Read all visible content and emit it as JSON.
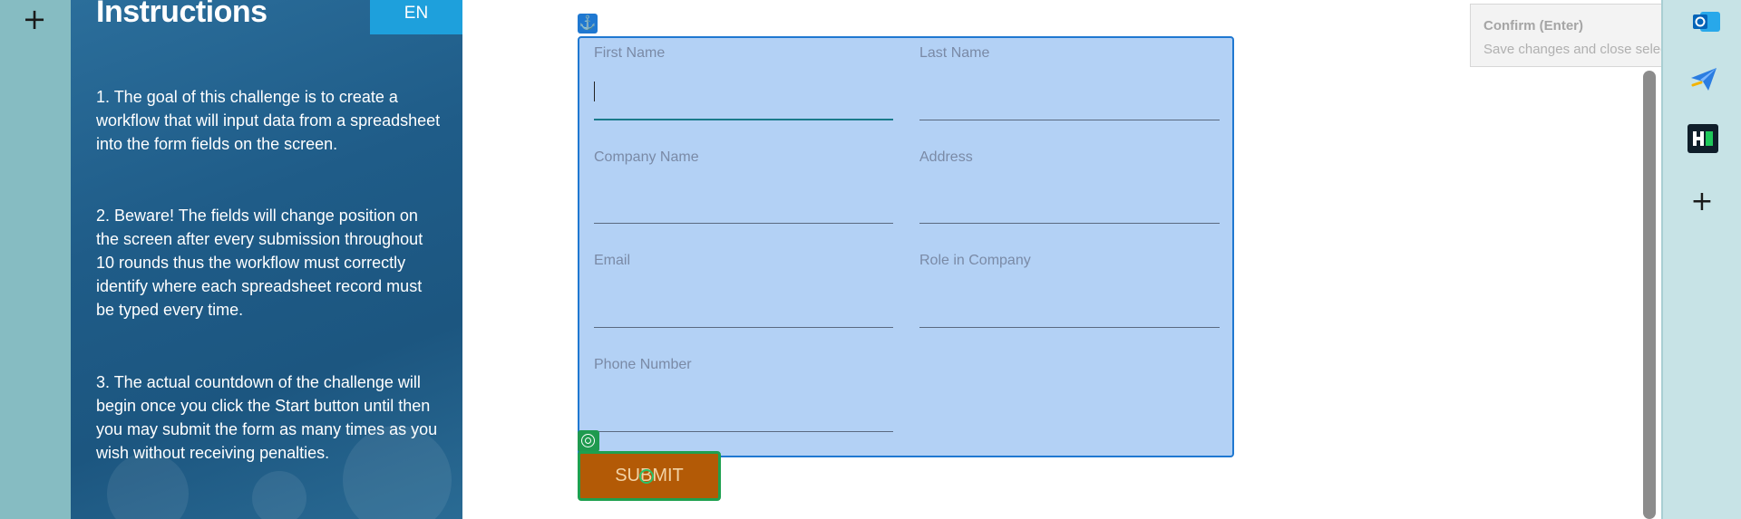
{
  "left_bar": {
    "add_label": "+"
  },
  "instructions": {
    "title": "Instructions",
    "language": "EN",
    "paragraphs": [
      "1. The goal of this challenge is to create a workflow that will input data from a spreadsheet into the form fields on the screen.",
      "2. Beware! The fields will change position on the screen after every submission throughout 10 rounds thus the workflow must correctly identify where each spreadsheet record must be typed every time.",
      "3. The actual countdown of the challenge will begin once you click the Start button until then you may submit the form as many times as you wish without receiving penalties."
    ]
  },
  "form": {
    "fields": [
      {
        "label": "First Name",
        "value": ""
      },
      {
        "label": "Last Name",
        "value": ""
      },
      {
        "label": "Company Name",
        "value": ""
      },
      {
        "label": "Address",
        "value": ""
      },
      {
        "label": "Email",
        "value": ""
      },
      {
        "label": "Role in Company",
        "value": ""
      },
      {
        "label": "Phone Number",
        "value": ""
      }
    ],
    "submit_label": "SUBMIT"
  },
  "tooltip": {
    "title": "Confirm (Enter)",
    "description": "Save changes and close selection wizard."
  },
  "right_bar": {
    "icons": [
      "outlook-icon",
      "send-icon",
      "hub-icon",
      "plus-icon"
    ],
    "add_label": "+"
  },
  "colors": {
    "form_highlight": "#b3d1f5",
    "selection_border": "#1f78d1",
    "submit_bg": "#b35a06",
    "submit_outline": "#1ea04f",
    "instructions_bg": "#1f5c88",
    "lang_button": "#1ea0dc"
  }
}
